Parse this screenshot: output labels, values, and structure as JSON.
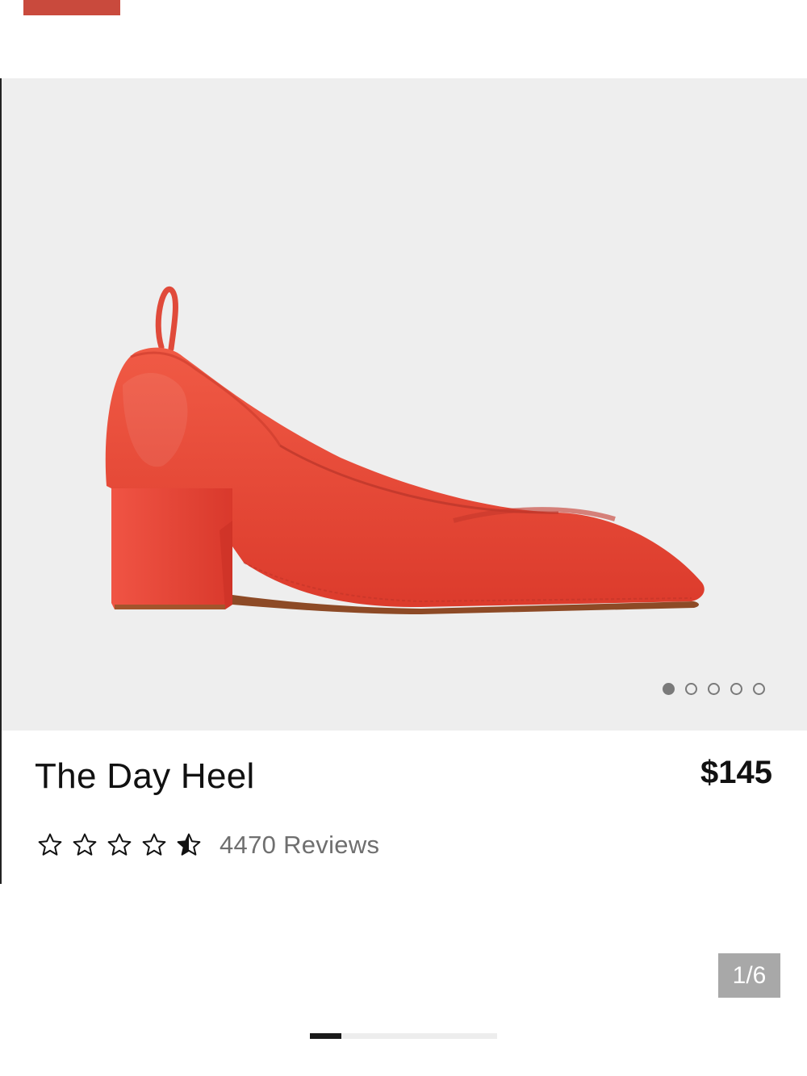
{
  "product": {
    "title": "The Day Heel",
    "price": "$145",
    "rating": 4.5,
    "rating_max": 5,
    "reviews_label": "4470 Reviews"
  },
  "gallery": {
    "dot_count": 5,
    "active_dot": 0,
    "counter_label": "1/6",
    "progress_fraction": 0.1667
  },
  "colors": {
    "accent_bar": "#c94a3d",
    "shoe": "#e8473a",
    "image_background": "#eeeeee"
  },
  "icons": {
    "star_full": "star-icon",
    "star_half": "half-star-icon",
    "image": "red-heel-shoe-image"
  }
}
